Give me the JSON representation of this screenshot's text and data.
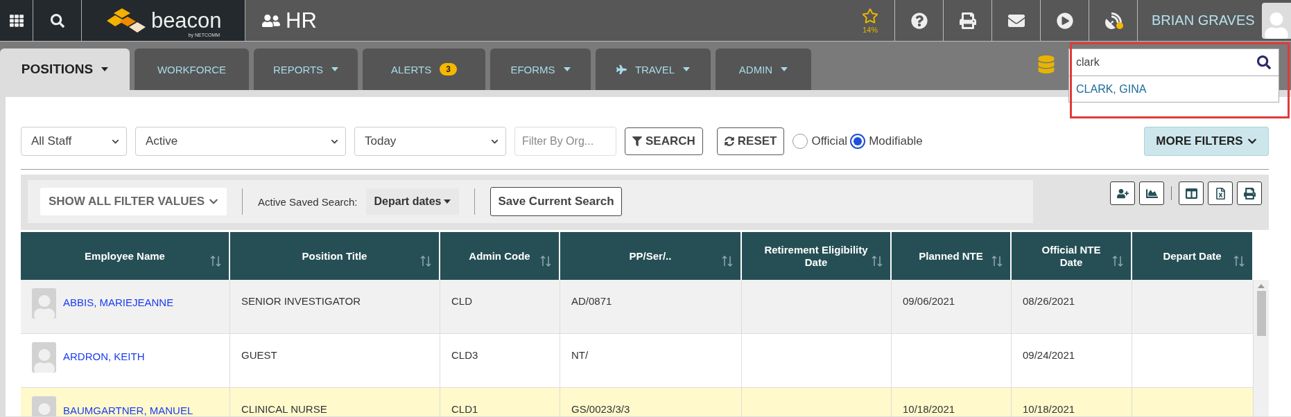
{
  "top_bar": {
    "logo": {
      "name": "beacon",
      "tagline": "by NETCOMM"
    },
    "app_title": "HR",
    "star_meter": "14%",
    "user_name": "BRIAN GRAVES"
  },
  "tabs": [
    {
      "label": "POSITIONS",
      "selected": true,
      "menu": true,
      "has_icon": false
    },
    {
      "label": "WORKFORCE",
      "selected": false,
      "menu": false,
      "has_icon": false
    },
    {
      "label": "REPORTS",
      "selected": false,
      "menu": true,
      "has_icon": false
    },
    {
      "label": "ALERTS",
      "selected": false,
      "menu": false,
      "badge": "3",
      "has_icon": false
    },
    {
      "label": "EFORMS",
      "selected": false,
      "menu": true,
      "has_icon": false
    },
    {
      "label": "TRAVEL",
      "selected": false,
      "menu": true,
      "has_icon": true
    },
    {
      "label": "ADMIN",
      "selected": false,
      "menu": true,
      "has_icon": false
    }
  ],
  "quick_search": {
    "value": "clark",
    "suggestions": [
      "CLARK, GINA"
    ]
  },
  "filters": {
    "staff": "All Staff",
    "status": "Active",
    "date": "Today",
    "org_placeholder": "Filter By Org...",
    "search_button": "SEARCH",
    "reset_button": "RESET",
    "radios": [
      {
        "label": "Official",
        "selected": false
      },
      {
        "label": "Modifiable",
        "selected": true
      }
    ],
    "more_filters": "MORE FILTERS"
  },
  "toolbar": {
    "show_all": "SHOW ALL FILTER VALUES",
    "saved_search_label": "Active Saved Search:",
    "saved_search": "Depart dates",
    "save_button": "Save Current Search"
  },
  "table": {
    "columns": [
      "Employee Name",
      "Position Title",
      "Admin Code",
      "PP/Ser/..",
      "Retirement Eligibility\nDate",
      "Planned NTE",
      "Official NTE\nDate",
      "Depart Date"
    ],
    "rows": [
      {
        "employee_name": "ABBIS, MARIEJEANNE",
        "position_title": "SENIOR INVESTIGATOR",
        "admin_code": "CLD",
        "pp_ser": "AD/0871",
        "planned_nte": "09/06/2021",
        "official_nte": "08/26/2021",
        "highlighted": false
      },
      {
        "employee_name": "ARDRON, KEITH",
        "position_title": "GUEST",
        "admin_code": "CLD3",
        "pp_ser": "NT/",
        "official_nte": "09/24/2021",
        "highlighted": false
      },
      {
        "employee_name": "BAUMGARTNER, MANUEL",
        "position_title": "CLINICAL NURSE",
        "admin_code": "CLD1",
        "pp_ser": "GS/0023/3/3",
        "planned_nte": "10/18/2021",
        "official_nte": "10/18/2021",
        "highlighted": true
      }
    ]
  }
}
